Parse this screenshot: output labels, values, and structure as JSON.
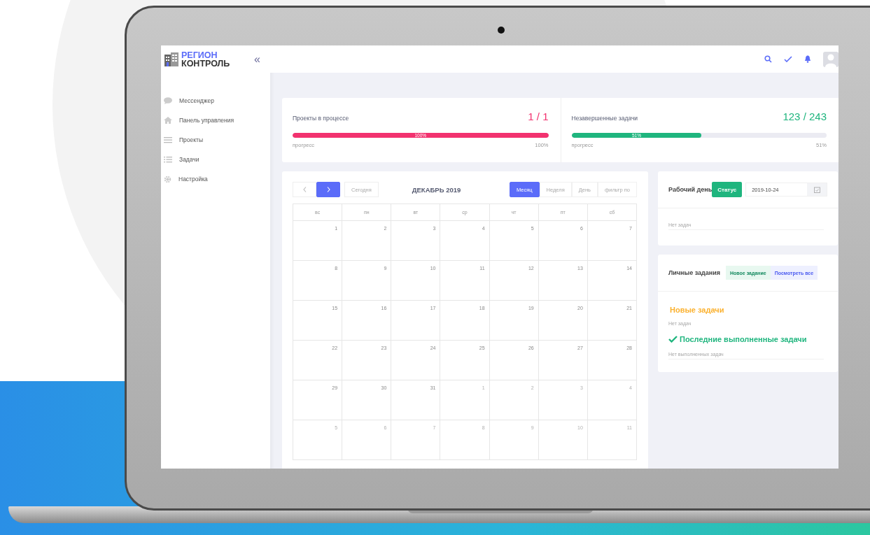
{
  "logo": {
    "line_1": "РЕГИОН",
    "line_2": "КОНТРОЛЬ"
  },
  "sidebar": {
    "collapse_icon": "«",
    "items": [
      {
        "kind": "chat",
        "label": "Мессенджер"
      },
      {
        "kind": "home",
        "label": "Панель управления"
      },
      {
        "kind": "menu",
        "label": "Проекты"
      },
      {
        "kind": "list",
        "label": "Задачи"
      },
      {
        "kind": "gear",
        "label": "Настройка"
      }
    ]
  },
  "stats": [
    {
      "title": "Проекты в процессе",
      "value": "1 / 1",
      "color": "#f2326f",
      "level": 1,
      "bar_label": "100%",
      "caption": "прогресс",
      "percent": "100%"
    },
    {
      "title": "Незавершенные задачи",
      "value": "123 / 243",
      "color": "#1fb57e",
      "level": 0.51,
      "bar_label": "51%",
      "caption": "прогресс",
      "percent": "51%"
    }
  ],
  "calendar": {
    "nav": [
      {
        "kind": "prev",
        "highlighted": false
      },
      {
        "kind": "next",
        "highlighted": true
      }
    ],
    "today": "Сегодня",
    "title": "ДЕКАБРЬ 2019",
    "views": [
      {
        "label": "Месяц",
        "selected": true
      },
      {
        "label": "Неделя",
        "selected": false
      },
      {
        "label": "День",
        "selected": false
      },
      {
        "label": "фильтр по",
        "selected": false
      }
    ],
    "weekdays": [
      "вс",
      "пн",
      "вт",
      "ср",
      "чт",
      "пт",
      "сб"
    ],
    "weeks": [
      [
        {
          "day": "1",
          "muted": false
        },
        {
          "day": "2",
          "muted": false
        },
        {
          "day": "3",
          "muted": false
        },
        {
          "day": "4",
          "muted": false
        },
        {
          "day": "5",
          "muted": false
        },
        {
          "day": "6",
          "muted": false
        },
        {
          "day": "7",
          "muted": false
        }
      ],
      [
        {
          "day": "8",
          "muted": false
        },
        {
          "day": "9",
          "muted": false
        },
        {
          "day": "10",
          "muted": false
        },
        {
          "day": "11",
          "muted": false
        },
        {
          "day": "12",
          "muted": false
        },
        {
          "day": "13",
          "muted": false
        },
        {
          "day": "14",
          "muted": false
        }
      ],
      [
        {
          "day": "15",
          "muted": false
        },
        {
          "day": "16",
          "muted": false
        },
        {
          "day": "17",
          "muted": false
        },
        {
          "day": "18",
          "muted": false
        },
        {
          "day": "19",
          "muted": false
        },
        {
          "day": "20",
          "muted": false
        },
        {
          "day": "21",
          "muted": false
        }
      ],
      [
        {
          "day": "22",
          "muted": false
        },
        {
          "day": "23",
          "muted": false
        },
        {
          "day": "24",
          "muted": false
        },
        {
          "day": "25",
          "muted": false
        },
        {
          "day": "26",
          "muted": false
        },
        {
          "day": "27",
          "muted": false
        },
        {
          "day": "28",
          "muted": false
        }
      ],
      [
        {
          "day": "29",
          "muted": false
        },
        {
          "day": "30",
          "muted": false
        },
        {
          "day": "31",
          "muted": false
        },
        {
          "day": "1",
          "muted": true
        },
        {
          "day": "2",
          "muted": true
        },
        {
          "day": "3",
          "muted": true
        },
        {
          "day": "4",
          "muted": true
        }
      ],
      [
        {
          "day": "5",
          "muted": true
        },
        {
          "day": "6",
          "muted": true
        },
        {
          "day": "7",
          "muted": true
        },
        {
          "day": "8",
          "muted": true
        },
        {
          "day": "9",
          "muted": true
        },
        {
          "day": "10",
          "muted": true
        },
        {
          "day": "11",
          "muted": true
        }
      ]
    ]
  },
  "workday": {
    "title": "Рабочий день",
    "status_button": "Статус",
    "date": "2019-10-24",
    "empty": "Нет задач"
  },
  "personal": {
    "title": "Личные задания",
    "new_button": "Новое задание",
    "view_all_button": "Посмотреть все",
    "new_heading": "Новые задачи",
    "new_empty": "Нет задач",
    "done_heading": "Последние выполненные задачи",
    "done_empty": "Нет выполненных задач"
  }
}
